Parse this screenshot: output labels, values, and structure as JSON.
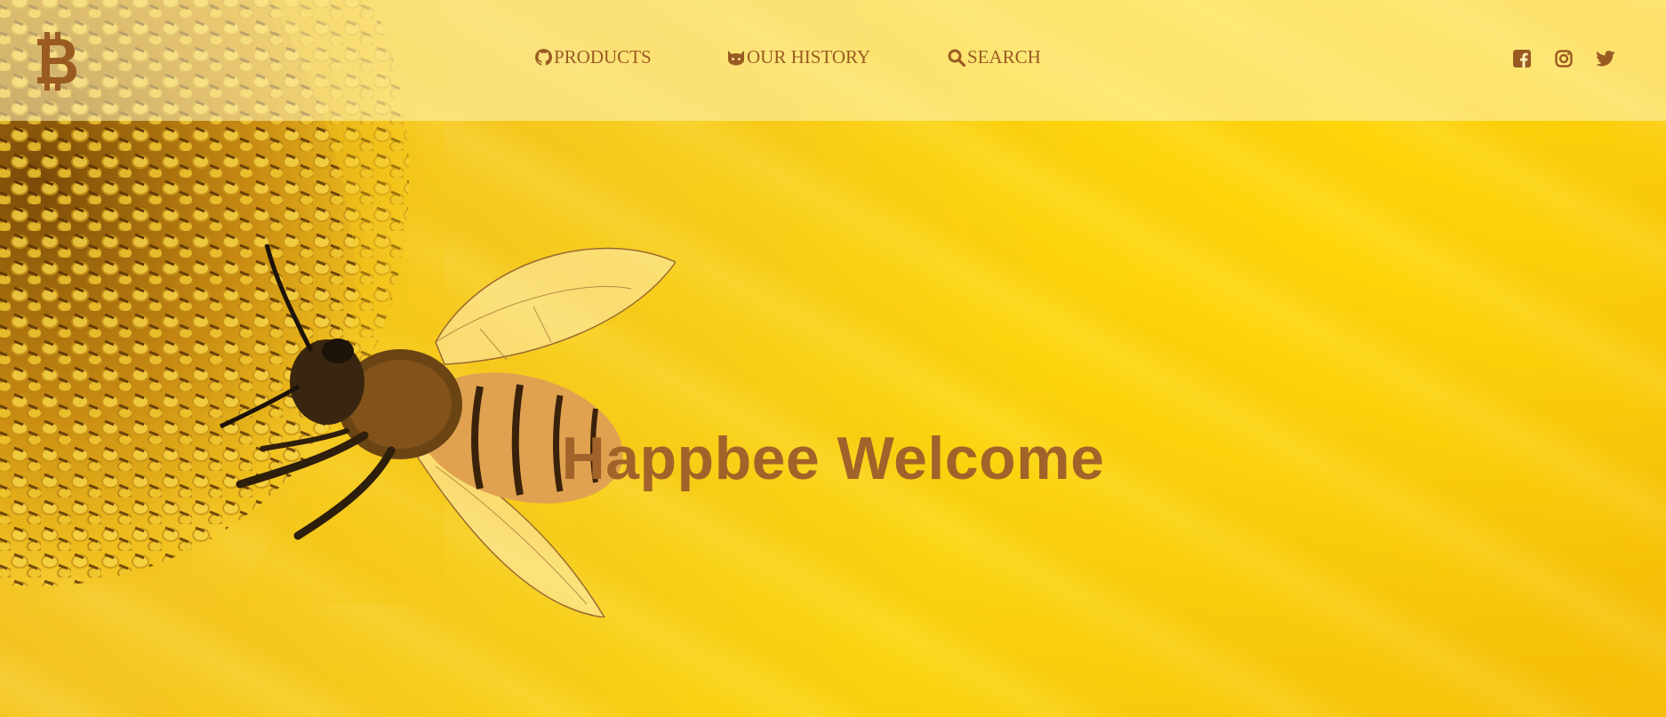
{
  "logo": {
    "icon": "bitcoin-icon"
  },
  "nav": {
    "items": [
      {
        "label": "PRODUCTS",
        "icon": "github-icon"
      },
      {
        "label": "OUR HISTORY",
        "icon": "cat-icon"
      },
      {
        "label": "SEARCH",
        "icon": "search-icon"
      }
    ]
  },
  "social": {
    "items": [
      {
        "icon": "facebook-icon"
      },
      {
        "icon": "instagram-icon"
      },
      {
        "icon": "twitter-icon"
      }
    ]
  },
  "hero": {
    "title": "Happbee Welcome"
  },
  "colors": {
    "accent": "#9a5b22",
    "header_bg": "#fff4be",
    "background": "#f9cd10"
  }
}
